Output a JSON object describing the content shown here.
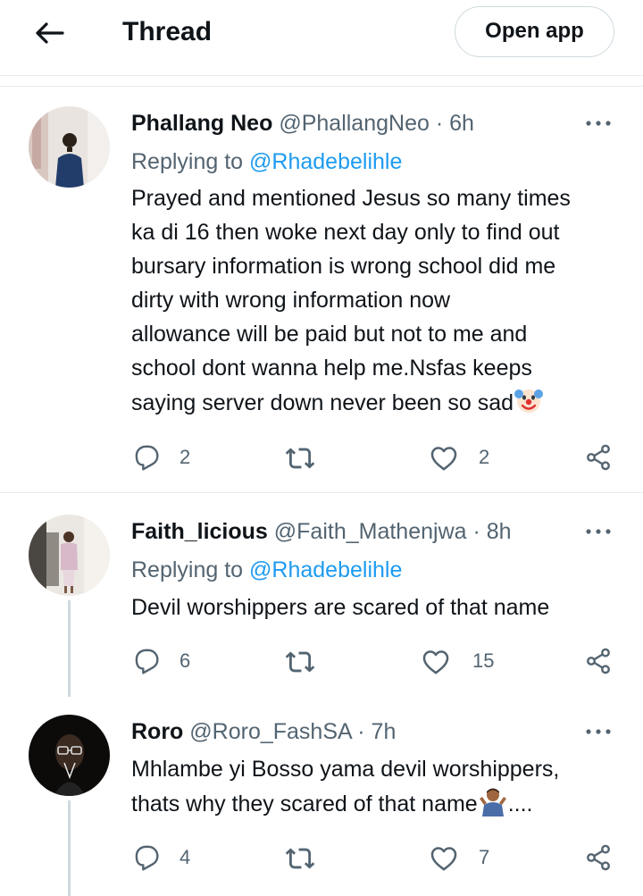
{
  "header": {
    "title": "Thread",
    "open_app_label": "Open app"
  },
  "tweets": [
    {
      "name": "Phallang Neo",
      "handle": "@PhallangNeo",
      "dot": "·",
      "time": "6h",
      "replying_prefix": "Replying to",
      "replying_to": "@Rhadebelihle",
      "lines": [
        "Prayed and mentioned Jesus so many times",
        "ka di 16 then woke next day only to find out",
        "bursary information is wrong school did me",
        "dirty with wrong information now",
        "allowance will be paid but not to me and",
        "school dont wanna help me.Nsfas keeps",
        "saying server down never been so sad"
      ],
      "emoji": "clown-face-emoji",
      "replies": "2",
      "retweets": "",
      "likes": "2"
    },
    {
      "name": "Faith_licious",
      "handle": "@Faith_Mathenjwa",
      "dot": "·",
      "time": "8h",
      "replying_prefix": "Replying to",
      "replying_to": "@Rhadebelihle",
      "lines": [
        "Devil worshippers are scared of that name"
      ],
      "replies": "6",
      "retweets": "",
      "likes": "15"
    },
    {
      "name": "Roro",
      "handle": "@Roro_FashSA",
      "dot": "·",
      "time": "7h",
      "lines": [
        "Mhlambe yi Bosso yama devil worshippers,",
        "thats why they scared of that name"
      ],
      "line_suffix": "....",
      "emoji": "person-shrugging-emoji",
      "replies": "4",
      "retweets": "",
      "likes": "7"
    }
  ],
  "colors": {
    "text": "#0f1419",
    "secondary": "#536471",
    "link": "#1d9bf0",
    "divider": "#e6ebee",
    "thread_line": "#cfd9de"
  },
  "icons": [
    "back-arrow-icon",
    "more-icon",
    "reply-icon",
    "retweet-icon",
    "like-icon",
    "share-icon"
  ]
}
